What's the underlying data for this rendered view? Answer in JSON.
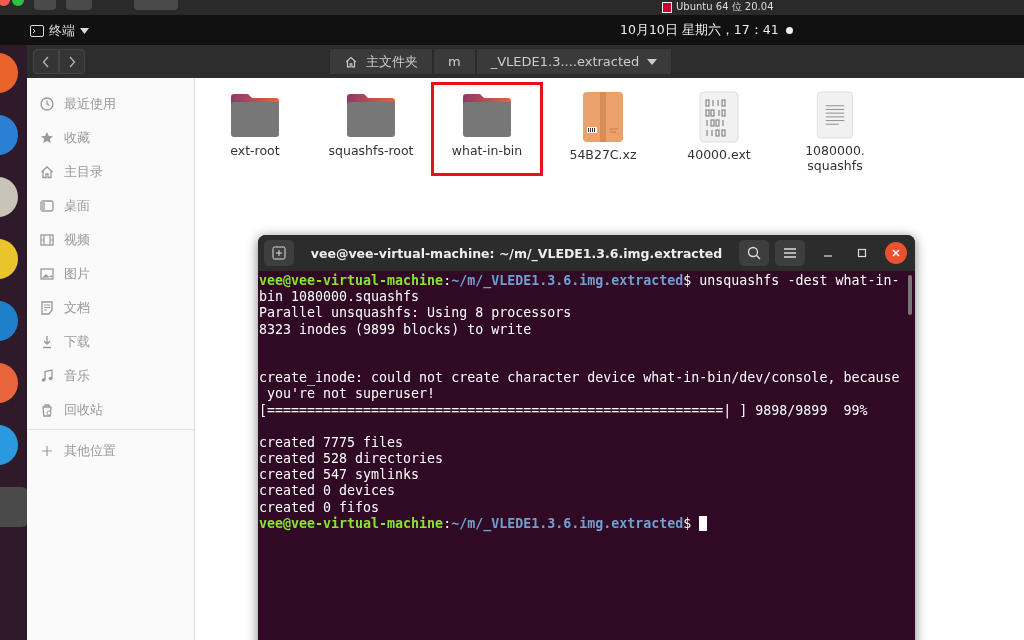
{
  "host_bar": {
    "title": "Ubuntu 64 位 20.04"
  },
  "top_bar": {
    "app_menu": "终端",
    "clock": "10月10日 星期六，17：41"
  },
  "file_manager": {
    "path": [
      {
        "label": "主文件夹",
        "home": true
      },
      {
        "label": "m",
        "home": false
      },
      {
        "label": "_VLEDE1.3....extracted",
        "home": false
      }
    ],
    "sidebar": {
      "items": [
        {
          "label": "最近使用"
        },
        {
          "label": "收藏"
        },
        {
          "label": "主目录"
        },
        {
          "label": "桌面"
        },
        {
          "label": "视频"
        },
        {
          "label": "图片"
        },
        {
          "label": "文档"
        },
        {
          "label": "下载"
        },
        {
          "label": "音乐"
        },
        {
          "label": "回收站"
        }
      ],
      "other": "其他位置"
    },
    "files": [
      {
        "name": "ext-root",
        "kind": "folder",
        "highlighted": false
      },
      {
        "name": "squashfs-root",
        "kind": "folder",
        "highlighted": false
      },
      {
        "name": "what-in-bin",
        "kind": "folder",
        "highlighted": true
      },
      {
        "name": "54B27C.xz",
        "kind": "archive",
        "highlighted": false
      },
      {
        "name": "40000.ext",
        "kind": "binary",
        "highlighted": false
      },
      {
        "name": "1080000.\nsquashfs",
        "kind": "text",
        "highlighted": false
      }
    ]
  },
  "terminal": {
    "title": "vee@vee-virtual-machine: ~/m/_VLEDE1.3.6.img.extracted",
    "lines": [
      {
        "kind": "prompt",
        "user": "vee@vee-virtual-machine",
        "separator": ":",
        "path": "~/m/_VLEDE1.3.6.img.extracted",
        "sigil": "$",
        "command": "unsquashfs -dest what-in-"
      },
      {
        "kind": "output",
        "text": "bin 1080000.squashfs"
      },
      {
        "kind": "output",
        "text": "Parallel unsquashfs: Using 8 processors"
      },
      {
        "kind": "output",
        "text": "8323 inodes (9899 blocks) to write"
      },
      {
        "kind": "blank"
      },
      {
        "kind": "blank"
      },
      {
        "kind": "output",
        "text": "create_inode: could not create character device what-in-bin/dev/console, because"
      },
      {
        "kind": "output",
        "text": " you're not superuser!"
      },
      {
        "kind": "output",
        "text": "[=========================================================| ] 9898/9899  99%"
      },
      {
        "kind": "blank"
      },
      {
        "kind": "output",
        "text": "created 7775 files"
      },
      {
        "kind": "output",
        "text": "created 528 directories"
      },
      {
        "kind": "output",
        "text": "created 547 symlinks"
      },
      {
        "kind": "output",
        "text": "created 0 devices"
      },
      {
        "kind": "output",
        "text": "created 0 fifos"
      },
      {
        "kind": "prompt",
        "user": "vee@vee-virtual-machine",
        "separator": ":",
        "path": "~/m/_VLEDE1.3.6.img.extracted",
        "sigil": "$",
        "cursor": true
      }
    ]
  }
}
